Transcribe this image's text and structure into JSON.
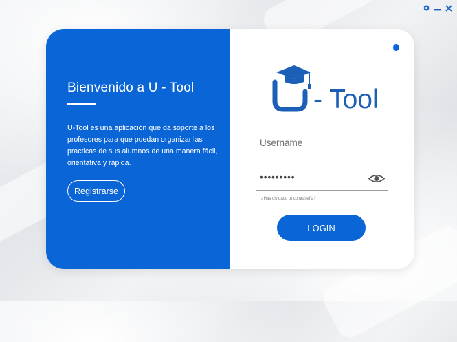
{
  "window": {
    "controls": [
      {
        "name": "settings",
        "icon": "gear-icon"
      },
      {
        "name": "minimize",
        "icon": "minimize-icon"
      },
      {
        "name": "close",
        "icon": "close-icon"
      }
    ]
  },
  "welcome": {
    "title": "Bienvenido a U - Tool",
    "description": "U-Tool es una aplicación que da soporte a los profesores para que puedan organizar las practicas de sus alumnos de una manera fácil, orientativa y rápida.",
    "register_label": "Registrarse"
  },
  "login": {
    "logo_text": "- Tool",
    "logo_icon": "graduation-cap-u-icon",
    "username_placeholder": "Username",
    "username_value": "",
    "password_value": "•••••••••",
    "show_password_icon": "eye-icon",
    "forgot_label": "¿Has olvidado tu contraseña?",
    "login_label": "LOGIN"
  },
  "colors": {
    "primary": "#0a66d6",
    "logo_blue": "#1b5fb7",
    "background": "#e8eaee"
  }
}
